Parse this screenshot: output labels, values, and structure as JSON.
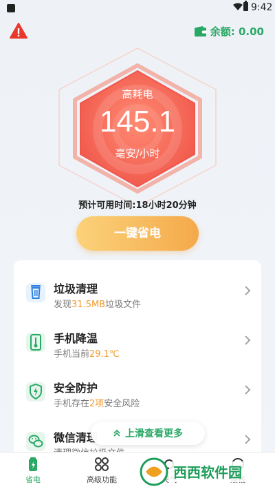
{
  "status": {
    "time": "9:42"
  },
  "header": {
    "balance": "余额: 0.00"
  },
  "meter": {
    "title": "高耗电",
    "value": "145.1",
    "unit": "毫安/小时"
  },
  "estimate": "预计可用时间:18小时20分钟",
  "save_button": "一键省电",
  "items": [
    {
      "title": "垃圾清理",
      "sub_pre": "发现",
      "sub_hl": "31.5MB",
      "sub_post": "垃圾文件",
      "icon": "trash-icon"
    },
    {
      "title": "手机降温",
      "sub_pre": "手机当前",
      "sub_hl": "29.1℃",
      "sub_post": "",
      "icon": "thermometer-icon"
    },
    {
      "title": "安全防护",
      "sub_pre": "手机存在",
      "sub_hl": "2项",
      "sub_post": "安全风险",
      "icon": "shield-icon"
    },
    {
      "title": "微信清理",
      "sub_pre": "清理微信垃圾文件",
      "sub_hl": "",
      "sub_post": "",
      "icon": "wechat-icon"
    }
  ],
  "more": "上滑查看更多",
  "nav": [
    {
      "label": "省电",
      "icon": "battery-icon"
    },
    {
      "label": "高级功能",
      "icon": "grid-icon"
    },
    {
      "label": "天气",
      "icon": "weather-icon"
    },
    {
      "label": "赚钱",
      "icon": "earn-icon"
    }
  ],
  "watermark": "西西软件园",
  "colors": {
    "accent_green": "#2aa866",
    "alert_red": "#f0574b",
    "highlight_orange": "#f29a2e",
    "button_orange": "#f4a94a"
  }
}
